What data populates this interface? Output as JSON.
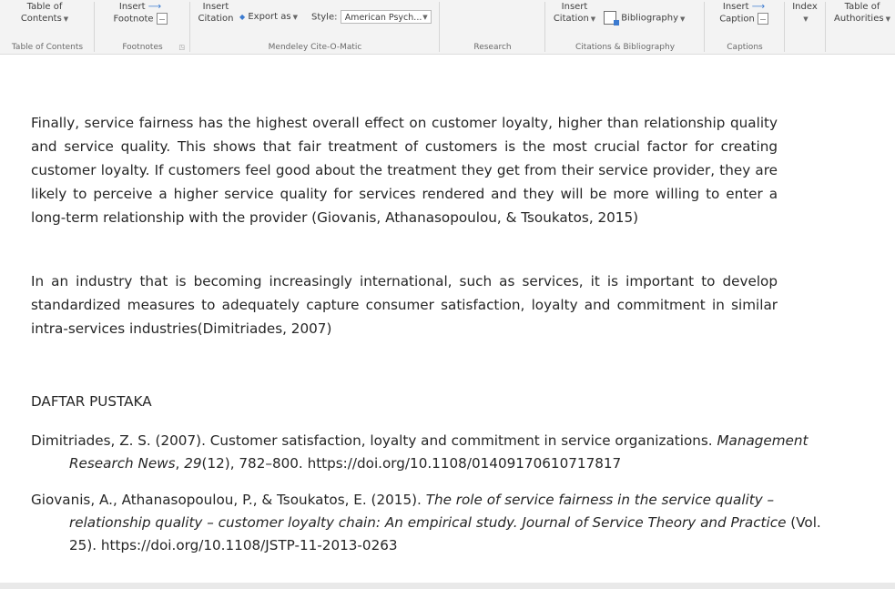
{
  "ribbon": {
    "groups": {
      "toc": {
        "button_line1": "Table of",
        "button_line2": "Contents",
        "label": "Table of Contents"
      },
      "footnotes": {
        "button_line1": "Insert",
        "button_line2": "Footnote",
        "label": "Footnotes"
      },
      "mendeley": {
        "citation_line1": "Insert",
        "citation_line2": "Citation",
        "export_label": "Export as",
        "style_label": "Style:",
        "style_value": "American Psych...",
        "label": "Mendeley Cite-O-Matic"
      },
      "research": {
        "label": "Research"
      },
      "citations": {
        "citation_line1": "Insert",
        "citation_line2": "Citation",
        "bibliography_label": "Bibliography",
        "label": "Citations & Bibliography"
      },
      "captions": {
        "button_line1": "Insert",
        "button_line2": "Caption",
        "label": "Captions"
      },
      "index": {
        "button_line1": "Index"
      },
      "authorities": {
        "button_line1": "Table of",
        "button_line2": "Authorities"
      }
    }
  },
  "document": {
    "paragraph1": "Finally, service fairness has the highest overall effect on customer loyalty, higher than relationship quality and service quality. This shows that fair treatment of customers is the most crucial factor for creating customer loyalty. If customers feel good about the treatment they get from their service provider, they are likely to perceive a higher service quality for services rendered and they will be more willing to enter a long-term relationship with the provider (Giovanis, Athanasopoulou, & Tsoukatos, 2015)",
    "paragraph2": "In an industry that is becoming increasingly international, such as services, it is important to develop standardized measures to adequately capture consumer satisfaction, loyalty and commitment in similar intra-services industries(Dimitriades, 2007)",
    "heading": "DAFTAR PUSTAKA",
    "references": [
      {
        "before": "Dimitriades, Z. S. (2007). Customer satisfaction, loyalty and commitment in service organizations. ",
        "italic": "Management Research News",
        "mid": ", ",
        "italic2": "29",
        "after": "(12), 782–800. https://doi.org/10.1108/01409170610717817"
      },
      {
        "before": "Giovanis, A., Athanasopoulou, P., & Tsoukatos, E. (2015). ",
        "italic": "The role of service fairness in the service quality – relationship quality – customer loyalty chain: An empirical study. Journal of Service Theory and Practice",
        "mid": "",
        "italic2": "",
        "after": " (Vol. 25). https://doi.org/10.1108/JSTP-11-2013-0263"
      }
    ]
  }
}
